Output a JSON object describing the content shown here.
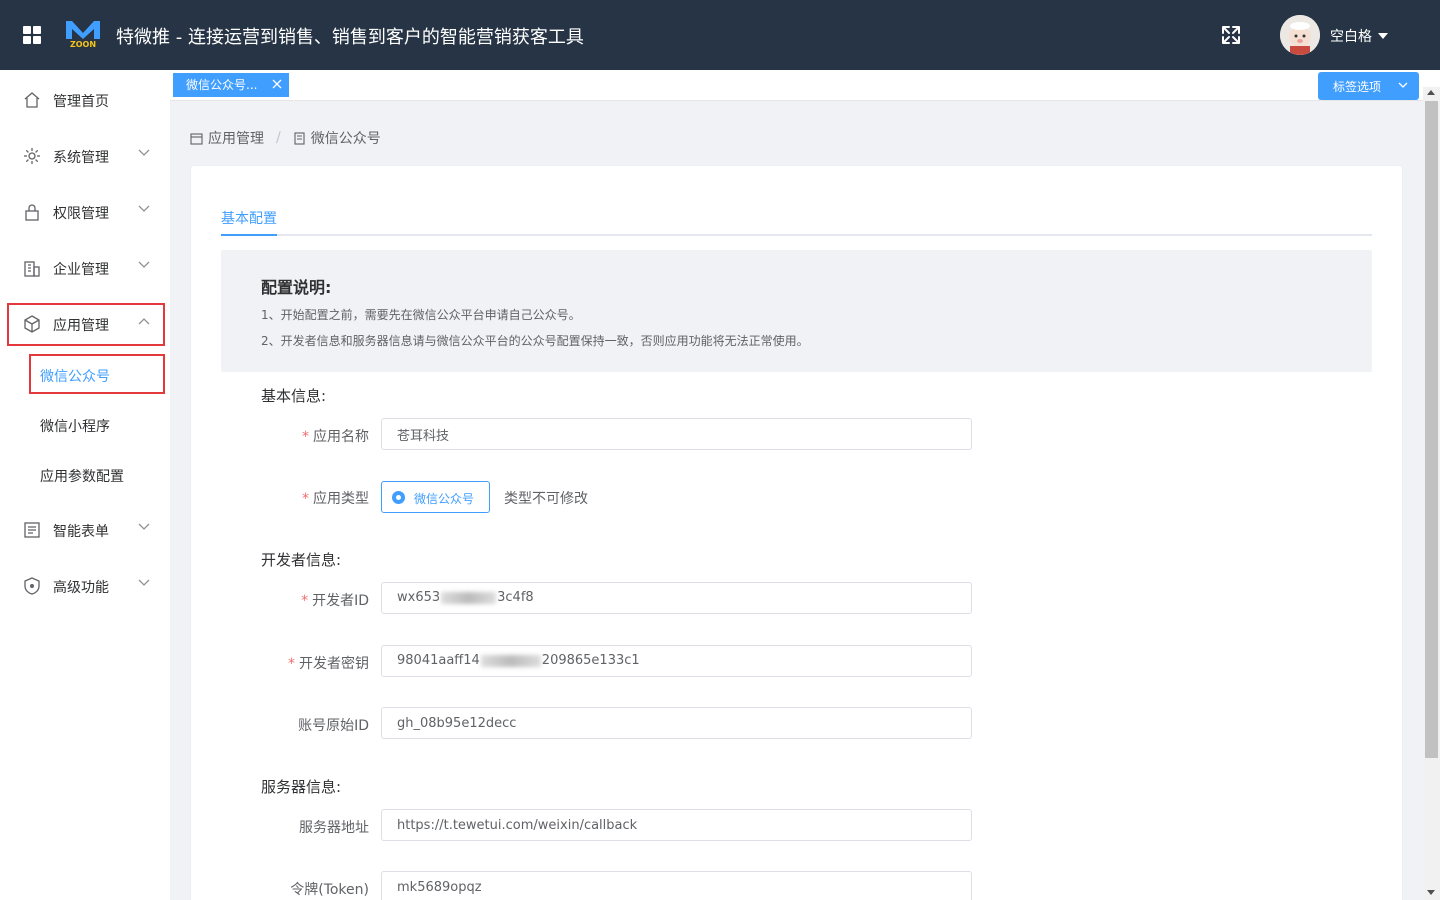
{
  "header": {
    "title": "特微推 - 连接运营到销售、销售到客户的智能营销获客工具",
    "username": "空白格",
    "logo_text": "ZOON"
  },
  "sidebar": {
    "items": [
      {
        "label": "管理首页",
        "icon": "home-icon"
      },
      {
        "label": "系统管理",
        "icon": "gear-icon"
      },
      {
        "label": "权限管理",
        "icon": "lock-icon"
      },
      {
        "label": "企业管理",
        "icon": "building-icon"
      },
      {
        "label": "应用管理",
        "icon": "cube-icon"
      },
      {
        "label": "智能表单",
        "icon": "form-icon"
      },
      {
        "label": "高级功能",
        "icon": "shield-icon"
      }
    ],
    "subitems": [
      {
        "label": "微信公众号"
      },
      {
        "label": "微信小程序"
      },
      {
        "label": "应用参数配置"
      }
    ]
  },
  "tags": {
    "active_tag": "微信公众号...",
    "options_label": "标签选项"
  },
  "breadcrumb": {
    "level1": "应用管理",
    "level2": "微信公众号"
  },
  "tab": {
    "label": "基本配置"
  },
  "note": {
    "title": "配置说明:",
    "line1": "1、开始配置之前，需要先在微信公众平台申请自己公众号。",
    "line2": "2、开发者信息和服务器信息请与微信公众平台的公众号配置保持一致，否则应用功能将无法正常使用。"
  },
  "form": {
    "basic_section": "基本信息:",
    "app_name_label": "应用名称",
    "app_name_value": "苍耳科技",
    "app_type_label": "应用类型",
    "app_type_option": "微信公众号",
    "app_type_hint": "类型不可修改",
    "dev_section": "开发者信息:",
    "dev_id_label": "开发者ID",
    "dev_id_prefix": "wx653",
    "dev_id_suffix": "3c4f8",
    "dev_secret_label": "开发者密钥",
    "dev_secret_prefix": "98041aaff14",
    "dev_secret_suffix": "209865e133c1",
    "origin_id_label": "账号原始ID",
    "origin_id_value": "gh_08b95e12decc",
    "server_section": "服务器信息:",
    "server_url_label": "服务器地址",
    "server_url_value": "https://t.tewetui.com/weixin/callback",
    "token_label": "令牌(Token)",
    "token_value": "mk5689opqz"
  },
  "colors": {
    "header_bg": "#263445",
    "accent": "#409eff",
    "highlight_box": "#e4393c",
    "required": "#f56c6c"
  }
}
